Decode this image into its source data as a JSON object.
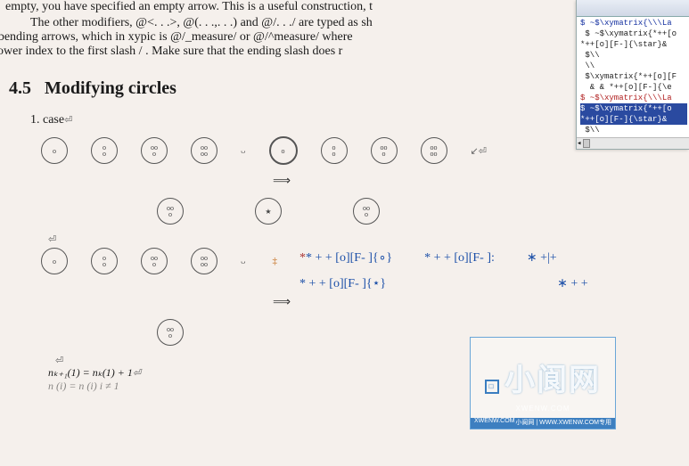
{
  "doc": {
    "partial_top": "empty, you have specified an empty arrow. This is a useful construction, t",
    "para2_a": "The other modifiers, @<. . .>, @(. . .,. . .) and @/. . ./ are typed as sh",
    "para2_b": "for bending arrows, which in xypic is @/_measure/ or @/^measure/ where",
    "para2_c": "or lower index to the first slash / . Make sure that the ending slash does r",
    "section_num": "4.5",
    "section_title": "Modifying circles",
    "case_num": "1.",
    "case_label": "case",
    "pilcrow": "⏎",
    "arrow": "⟹",
    "formula_row1": {
      "a": "* + + [o][F- ]{∘}",
      "b": "* + + [o][F- ]:",
      "c": "∗ +|+"
    },
    "formula_row2": {
      "a": "* + + [o][F- ]{⋆}",
      "b": "∗ + +"
    },
    "eq1": "nₖ₊₁(1) = nₖ(1) + 1",
    "eq2_partial": "n   (i) = n (i)    i ≠ 1"
  },
  "panel": {
    "lines": [
      {
        "cls": "blue",
        "t": "$ ~$\\xymatrix{\\\\\\La"
      },
      {
        "cls": "blk",
        "t": " $ ~$\\xymatrix{*++[o"
      },
      {
        "cls": "blk",
        "t": "*++[o][F-]{\\star}&"
      },
      {
        "cls": "blk",
        "t": " $\\\\"
      },
      {
        "cls": "blk",
        "t": " \\\\"
      },
      {
        "cls": "blk",
        "t": " $\\xymatrix{*++[o][F"
      },
      {
        "cls": "blk",
        "t": "  & & *++[o][F-]{\\e"
      },
      {
        "cls": "red",
        "t": "$ ~$\\xymatrix{\\\\\\La"
      },
      {
        "cls": "sel",
        "t": "$ ~$\\xymatrix{*++[o"
      },
      {
        "cls": "sel",
        "t": "*++[o][F-]{\\star}&"
      },
      {
        "cls": "blk",
        "t": " $\\\\"
      }
    ],
    "scroll_thumb": "◂"
  },
  "watermark": {
    "square": "□",
    "big": "小阆网",
    "sm": "XWENW.COM",
    "bar_left": "XWENW.COM",
    "bar_right": "小阆网 | WWW.XWENW.COM专用"
  }
}
